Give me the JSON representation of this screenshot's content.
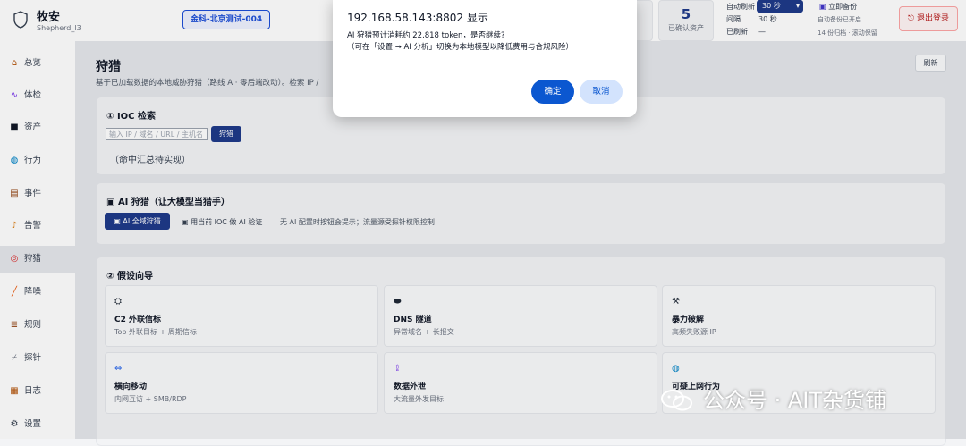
{
  "header": {
    "brand_name": "牧安",
    "brand_sub": "Shepherd_l3",
    "workspace": "金科-北京测试-004",
    "confirmed_assets_count": "5",
    "confirmed_assets_label": "已确认资产",
    "auto_refresh_label": "自动刷新",
    "auto_refresh_value": "30 秒",
    "interval_label": "间隔",
    "interval_value": "30 秒",
    "refreshed_label": "已刷新",
    "refreshed_value": "—",
    "backup_button": "立即备份",
    "backup_status": "自动备份已开启",
    "backup_schedule": "14 份归档 · 滚动保留",
    "logout_button": "退出登录"
  },
  "sidebar": {
    "items": [
      {
        "label": "总览",
        "icon": "home-icon"
      },
      {
        "label": "体检",
        "icon": "pulse-icon"
      },
      {
        "label": "资产",
        "icon": "box-icon"
      },
      {
        "label": "行为",
        "icon": "globe-icon"
      },
      {
        "label": "事件",
        "icon": "file-icon"
      },
      {
        "label": "告警",
        "icon": "bell-icon"
      },
      {
        "label": "狩猎",
        "icon": "target-icon",
        "active": true
      },
      {
        "label": "降噪",
        "icon": "wand-icon"
      },
      {
        "label": "规则",
        "icon": "list-icon"
      },
      {
        "label": "探针",
        "icon": "probe-icon"
      },
      {
        "label": "日志",
        "icon": "log-icon"
      },
      {
        "label": "设置",
        "icon": "gear-icon"
      }
    ]
  },
  "main": {
    "title": "狩猎",
    "description": "基于已加载数据的本地威胁狩猎（路线 A · 零后端改动）。检索 IP /",
    "refresh_button": "刷新",
    "ioc": {
      "title": "① IOC 检索",
      "input_placeholder": "输入 IP / 域名 / URL / 主机名",
      "hunt_button": "狩猎",
      "empty_text": "（命中汇总待实现）"
    },
    "ai": {
      "title": "AI 狩猎（让大模型当猎手）",
      "full_hunt_button": "AI 全域狩猎",
      "verify_button": "用当前 IOC 做 AI 验证",
      "hint": "无 AI 配置时按钮会提示；流量源受探针权限控制"
    },
    "hypotheses": {
      "title": "② 假设向导",
      "items": [
        {
          "title": "C2 外联信标",
          "desc": "Top 外联目标 + 周期信标",
          "icon": "satellite-icon"
        },
        {
          "title": "DNS 隧道",
          "desc": "异常域名 + 长报文",
          "icon": "tunnel-icon"
        },
        {
          "title": "暴力破解",
          "desc": "高频失败源 IP",
          "icon": "hammer-icon"
        },
        {
          "title": "横向移动",
          "desc": "内网互访 + SMB/RDP",
          "icon": "arrows-icon"
        },
        {
          "title": "数据外泄",
          "desc": "大流量外发目标",
          "icon": "upload-icon"
        },
        {
          "title": "可疑上网行为",
          "desc": "",
          "icon": "globe-icon"
        }
      ]
    }
  },
  "dialog": {
    "title": "192.168.58.143:8802 显示",
    "message_line1": "AI 狩猎预计消耗约 22,818 token，是否继续?",
    "message_line2": "（可在「设置 → AI 分析」切换为本地模型以降低费用与合规风险）",
    "ok_button": "确定",
    "cancel_button": "取消"
  },
  "watermark": {
    "text": "公众号 · AIT杂货铺"
  }
}
